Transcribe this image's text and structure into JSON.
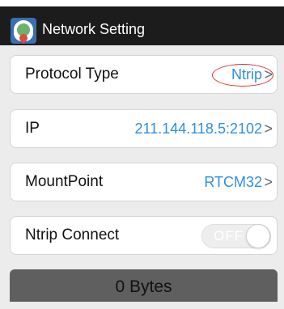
{
  "header": {
    "title": "Network Setting",
    "icon": "app-gps-icon"
  },
  "settings": {
    "protocol": {
      "label": "Protocol Type",
      "value": "Ntrip",
      "chevron": ">"
    },
    "ip": {
      "label": "IP",
      "value": "211.144.118.5:2102",
      "chevron": ">"
    },
    "mountpoint": {
      "label": "MountPoint",
      "value": "RTCM32",
      "chevron": ">"
    },
    "ntrip_connect": {
      "label": "Ntrip Connect",
      "toggle_text": "OFF",
      "on": false
    }
  },
  "status": {
    "bytes_text": "0 Bytes"
  },
  "colors": {
    "accent": "#2f8fe0",
    "highlight": "#d9302a",
    "titlebar": "#1c1c1c"
  }
}
